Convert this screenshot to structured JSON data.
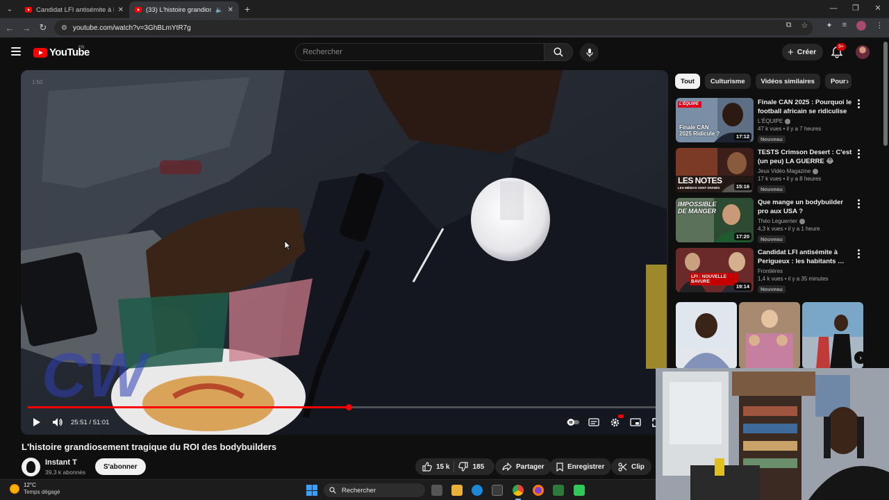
{
  "browser": {
    "tabs": [
      {
        "title": "Candidat LFI antisémite à Perig",
        "active": false
      },
      {
        "title": "(33) L'histoire grandioseme",
        "active": true
      }
    ],
    "url": "youtube.com/watch?v=3GhBLmYtR7g"
  },
  "masthead": {
    "logo_text": "YouTube",
    "country": "FR",
    "search_placeholder": "Rechercher",
    "create_label": "Créer",
    "notifications_badge": "9+"
  },
  "player": {
    "ghost_time": "1:50",
    "timecode": "25:51 / 51:01",
    "progress": 0.507
  },
  "video": {
    "title": "L'histoire grandiosement tragique du ROI des bodybuilders",
    "channel": "Instant T",
    "subscribers": "39,3 k abonnés",
    "subscribe_label": "S'abonner",
    "likes": "15 k",
    "dislikes": "185",
    "share_label": "Partager",
    "save_label": "Enregistrer",
    "clip_label": "Clip"
  },
  "sidebar": {
    "chips": [
      "Tout",
      "Culturisme",
      "Vidéos similaires",
      "Pour"
    ],
    "recommendations": [
      {
        "title": "Finale CAN 2025 : Pourquoi le football africain se ridiculise",
        "channel": "L'ÉQUIPE",
        "meta": "47 k vues • il y a 7 heures",
        "badge": "Nouveau",
        "duration": "17:12",
        "thumb_text": "Finale CAN 2025 Ridicule ?",
        "brand": "L'ÉQUIPE"
      },
      {
        "title": "TESTS Crimson Desert : C'est (un peu) LA GUERRE 😂 Qu'en…",
        "channel": "Jeux Vidéo Magazine",
        "meta": "17 k vues • il y a 8 heures",
        "badge": "Nouveau",
        "duration": "15:16",
        "thumb_text": "LES NOTES",
        "thumb_sub": "LES MÉDIAS SONT DIVISÉS"
      },
      {
        "title": "Que mange un bodybuilder pro aux USA ?",
        "channel": "Théo Leguerrier",
        "meta": "4,3 k vues • il y a 1 heure",
        "badge": "Nouveau",
        "duration": "17:20",
        "thumb_text": "IMPOSSIBLE DE MANGER"
      },
      {
        "title": "Candidat LFI antisémite à Perigueux : les habitants …",
        "channel": "Frontières",
        "meta": "1,4 k vues • il y a 35 minutes",
        "badge": "Nouveau",
        "duration": "19:14",
        "thumb_text": "LFI : NOUVELLE BAVURE"
      }
    ]
  },
  "taskbar": {
    "temperature": "12°C",
    "weather": "Temps dégagé",
    "search_label": "Rechercher"
  },
  "colors": {
    "accent_red": "#ff0000",
    "bg": "#0f0f0f",
    "chip_bg": "#272727"
  }
}
